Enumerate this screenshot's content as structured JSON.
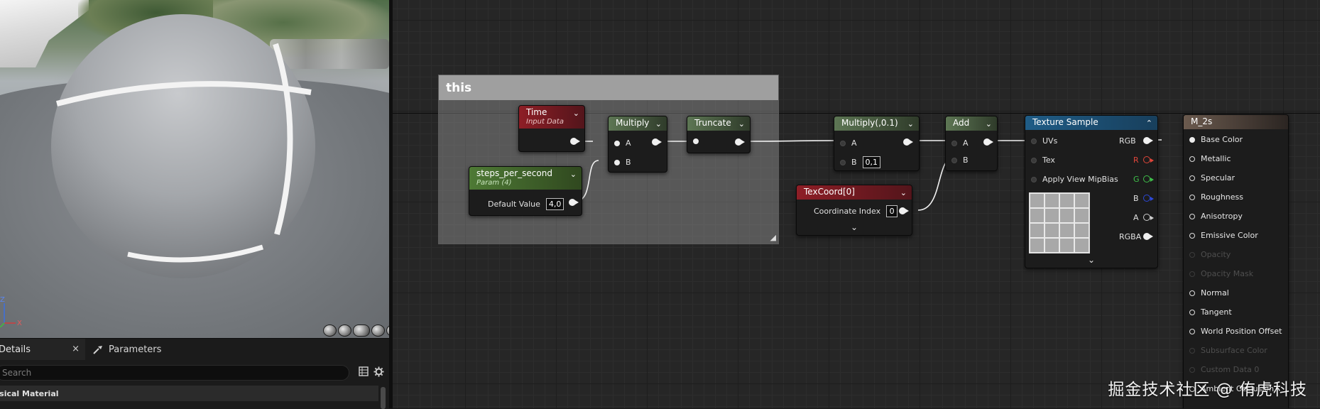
{
  "details_panel": {
    "tab_details_label": "Details",
    "tab_close_glyph": "×",
    "tab_parameters_label": "Parameters",
    "search_placeholder": "Search",
    "section_label": "ysical Material"
  },
  "graph": {
    "comment_title": "this",
    "nodes": {
      "time": {
        "title": "Time",
        "subtitle": "Input Data"
      },
      "steps": {
        "title": "steps_per_second",
        "subtitle": "Param (4)",
        "default_label": "Default Value",
        "default_value": "4,0"
      },
      "multiply1": {
        "title": "Multiply",
        "pin_a": "A",
        "pin_b": "B"
      },
      "truncate": {
        "title": "Truncate"
      },
      "multiply2": {
        "title": "Multiply(,0.1)",
        "pin_a": "A",
        "pin_b": "B",
        "b_value": "0,1"
      },
      "texcoord": {
        "title": "TexCoord[0]",
        "index_label": "Coordinate Index",
        "index_value": "0"
      },
      "add": {
        "title": "Add",
        "pin_a": "A",
        "pin_b": "B"
      },
      "texture_sample": {
        "title": "Texture Sample",
        "inputs": [
          "UVs",
          "Tex",
          "Apply View MipBias"
        ],
        "outputs": [
          "RGB",
          "R",
          "G",
          "B",
          "A",
          "RGBA"
        ]
      },
      "material": {
        "title": "M_2s",
        "pins": [
          {
            "label": "Base Color",
            "state": "connected"
          },
          {
            "label": "Metallic",
            "state": "enabled"
          },
          {
            "label": "Specular",
            "state": "enabled"
          },
          {
            "label": "Roughness",
            "state": "enabled"
          },
          {
            "label": "Anisotropy",
            "state": "enabled"
          },
          {
            "label": "Emissive Color",
            "state": "enabled"
          },
          {
            "label": "Opacity",
            "state": "disabled"
          },
          {
            "label": "Opacity Mask",
            "state": "disabled"
          },
          {
            "label": "Normal",
            "state": "enabled"
          },
          {
            "label": "Tangent",
            "state": "enabled"
          },
          {
            "label": "World Position Offset",
            "state": "enabled"
          },
          {
            "label": "Subsurface Color",
            "state": "disabled"
          },
          {
            "label": "Custom Data 0",
            "state": "disabled"
          },
          {
            "label": "Ambient Occlusion",
            "state": "enabled"
          }
        ]
      }
    }
  },
  "viewport": {
    "axis_z": "Z",
    "axis_x": "X"
  },
  "watermark": "掘金技术社区 @ 侑虎科技",
  "colors": {
    "node_red": "#8e1e26",
    "node_green": "#5d7654",
    "node_blue": "#1f5c86",
    "pin_r": "#e0463a",
    "pin_g": "#3fbf4a",
    "pin_b": "#2d49d9"
  },
  "icons": [
    "close-icon",
    "parameters-icon",
    "table-view-icon",
    "settings-icon",
    "chevron-down-icon"
  ]
}
